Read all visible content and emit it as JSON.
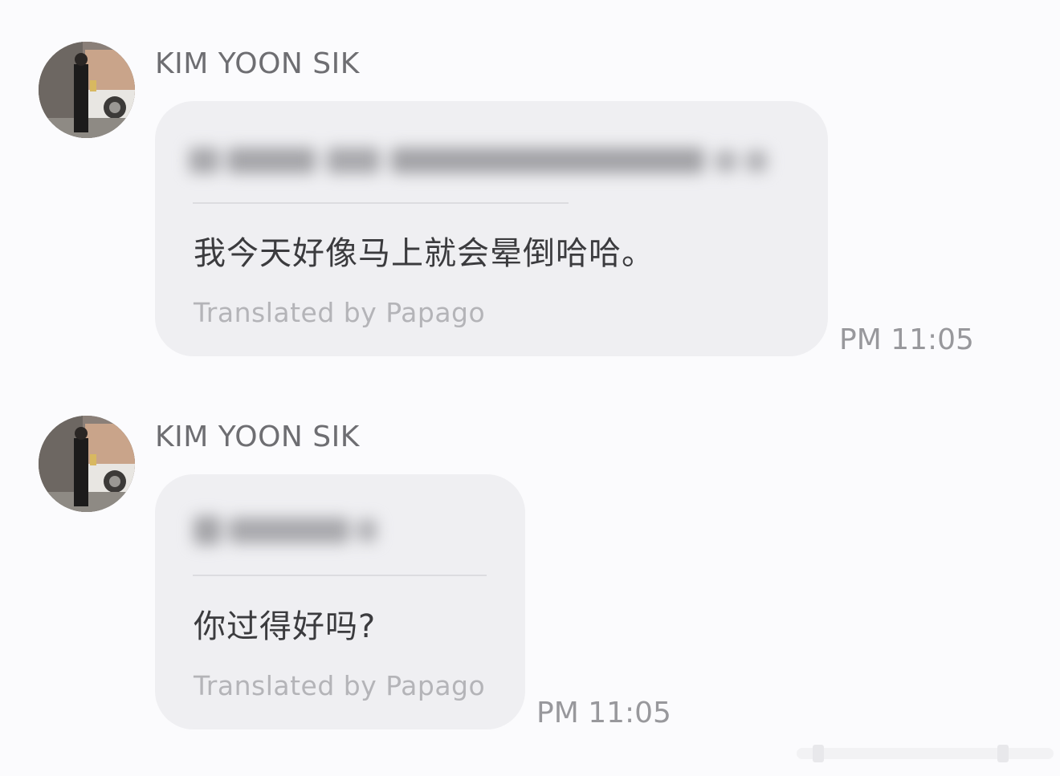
{
  "messages": [
    {
      "sender": "KIM YOON SIK",
      "translated_text": "我今天好像马上就会晕倒哈哈。",
      "translation_credit": "Translated by Papago",
      "time": "PM 11:05"
    },
    {
      "sender": "KIM YOON SIK",
      "translated_text": "你过得好吗?",
      "translation_credit": "Translated by Papago",
      "time": "PM 11:05"
    }
  ],
  "colors": {
    "background": "#fbfbfd",
    "bubble": "#efeff2",
    "sender_text": "#6e6e72",
    "message_text": "#3b3b3e",
    "credit_text": "#b4b4b8",
    "time_text": "#98989c"
  },
  "icons": {
    "avatar": "profile-photo"
  }
}
